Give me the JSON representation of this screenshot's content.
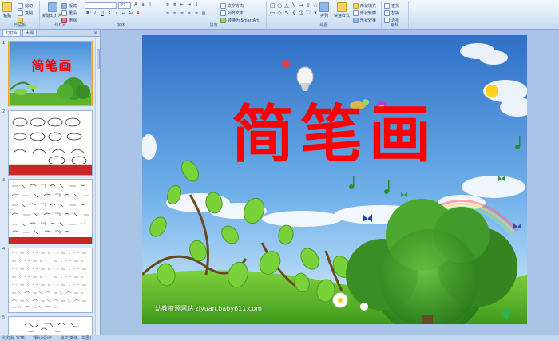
{
  "ribbon": {
    "clipboard": {
      "label": "剪贴板",
      "paste": "粘贴",
      "cut": "剪切",
      "copy": "复制",
      "format_painter": "格式刷"
    },
    "slides": {
      "label": "幻灯片",
      "new_slide": "新建幻灯片",
      "layout": "版式",
      "reset": "重设",
      "delete": "删除"
    },
    "font": {
      "label": "字体",
      "font_size": "22"
    },
    "paragraph": {
      "label": "段落",
      "text_direction": "文字方向",
      "align_text": "对齐文本",
      "smartart": "转换为 SmartArt"
    },
    "drawing": {
      "label": "绘图",
      "arrange": "排列",
      "quick_styles": "快速样式",
      "shape_fill": "形状填充",
      "shape_outline": "形状轮廓",
      "shape_effects": "形状效果"
    },
    "editing": {
      "label": "编辑",
      "find": "查找",
      "replace": "替换",
      "select": "选择"
    }
  },
  "pane": {
    "tab_slides": "幻灯片",
    "tab_outline": "大纲",
    "close": "×"
  },
  "thumbnails": [
    {
      "num": "1",
      "title": "简笔画"
    },
    {
      "num": "2"
    },
    {
      "num": "3"
    },
    {
      "num": "4"
    },
    {
      "num": "5"
    }
  ],
  "slide": {
    "title": "简笔画",
    "watermark": "幼教资源网站  ziyuan.baby611.com",
    "title_color": "#ff0000"
  },
  "status": {
    "slide_count": "幻灯片 1/78",
    "theme": "\"默认设计\"",
    "language": "中文(简体，中国)"
  }
}
